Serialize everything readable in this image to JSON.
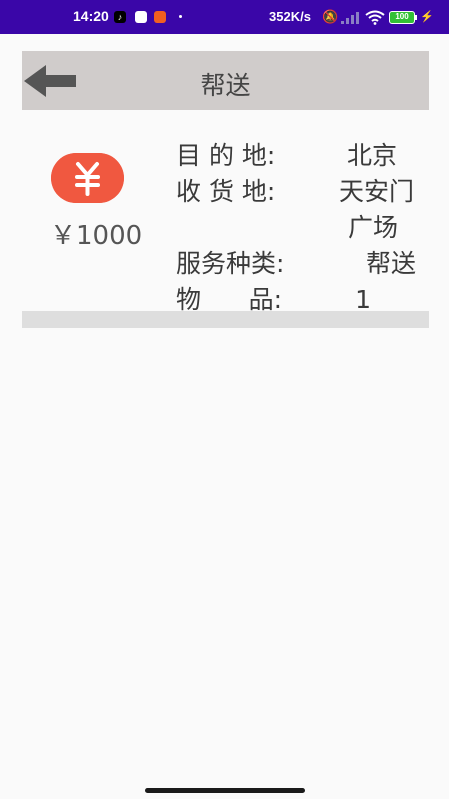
{
  "status_bar": {
    "time": "14:20",
    "network_speed": "352K/s",
    "battery_level": "100",
    "battery_color": "#32c036",
    "background": "#3a06a8",
    "icons": [
      "tiktok-icon",
      "app-icon",
      "mi-icon",
      "bell-muted-icon",
      "signal-icon",
      "wifi-icon",
      "battery-icon",
      "charging-icon"
    ]
  },
  "header": {
    "title": "帮送",
    "back_icon": "arrow-left-icon",
    "background": "#d0cccb"
  },
  "order": {
    "price": "￥1000",
    "badge_symbol": "¥",
    "badge_color": "#f05840",
    "destination_label": "目 的 地:",
    "destination_value": "北京",
    "pickup_label": "收 货 地:",
    "pickup_value_line1": "天安门",
    "pickup_value_line2": "广场",
    "service_label": "服务种类:",
    "service_value": "帮送",
    "item_label": "物      品:",
    "item_value": "1"
  }
}
